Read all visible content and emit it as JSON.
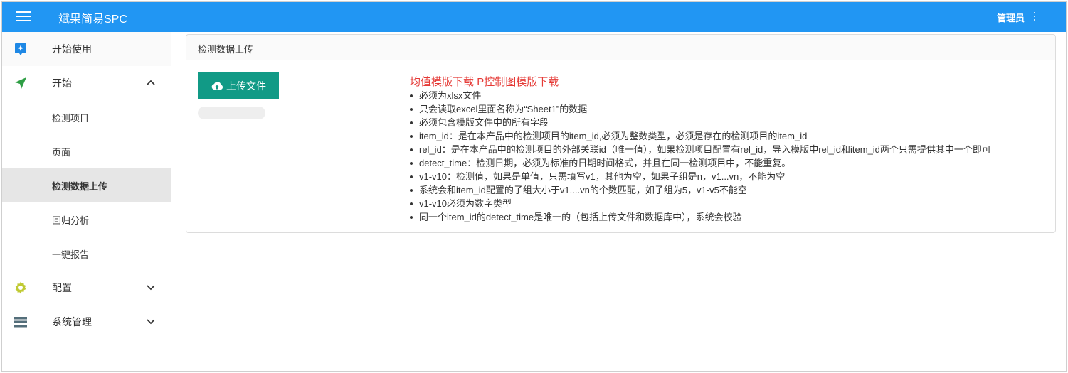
{
  "app": {
    "title": "斌果简易SPC",
    "user": "管理员",
    "brand_color": "#2196f3"
  },
  "sidebar": {
    "items": [
      {
        "label": "开始使用",
        "icon": "sparkle-badge-icon"
      },
      {
        "label": "开始",
        "icon": "navigation-arrow-icon",
        "expanded": true
      },
      {
        "label": "检测项目"
      },
      {
        "label": "页面"
      },
      {
        "label": "检测数据上传",
        "selected": true
      },
      {
        "label": "回归分析"
      },
      {
        "label": "一键报告"
      },
      {
        "label": "配置",
        "icon": "gear-icon",
        "expanded": false
      },
      {
        "label": "系统管理",
        "icon": "list-icon",
        "expanded": false
      }
    ]
  },
  "main": {
    "card_title": "检测数据上传",
    "upload_label": "上传文件",
    "link_mean_template": "均值模版下载",
    "link_p_template": "P控制图模版下载",
    "rules": [
      "必须为xlsx文件",
      "只会读取excel里面名称为“Sheet1”的数据",
      "必须包含模版文件中的所有字段",
      "item_id：是在本产品中的检测项目的item_id,必须为整数类型，必须是存在的检测项目的item_id",
      "rel_id：是在本产品中的检测项目的外部关联id（唯一值），如果检测项目配置有rel_id，导入模版中rel_id和item_id两个只需提供其中一个即可",
      "detect_time：检测日期，必须为标准的日期时间格式，并且在同一检测项目中，不能重复。",
      "v1-v10：检测值，如果是单值，只需填写v1，其他为空，如果子组是n，v1...vn，不能为空",
      "系统会和item_id配置的子组大小于v1....vn的个数匹配，如子组为5，v1-v5不能空",
      "v1-v10必须为数字类型",
      "同一个item_id的detect_time是唯一的（包括上传文件和数据库中），系统会校验"
    ],
    "accent_color": "#119a86",
    "link_color": "#e53935"
  }
}
